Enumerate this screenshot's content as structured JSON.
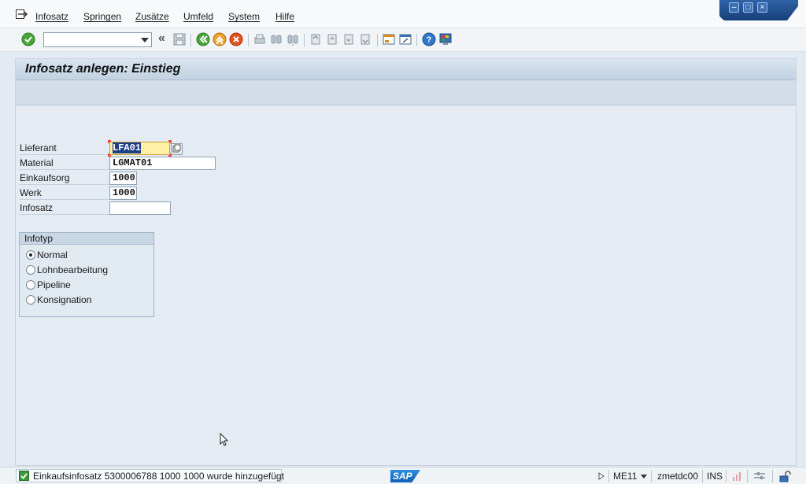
{
  "menubar": {
    "items": [
      "Infosatz",
      "Springen",
      "Zusätze",
      "Umfeld",
      "System",
      "Hilfe"
    ],
    "icon": "menu-icon"
  },
  "window_controls": {
    "minimize": "–",
    "maximize": "□",
    "close": "×"
  },
  "toolbar": {
    "command_field_value": "",
    "back_glyph": "«"
  },
  "screen": {
    "title": "Infosatz anlegen: Einstieg"
  },
  "form": {
    "fields": [
      {
        "label": "Lieferant",
        "value": "LFA01"
      },
      {
        "label": "Material",
        "value": "LGMAT01"
      },
      {
        "label": "Einkaufsorg",
        "value": "1000"
      },
      {
        "label": "Werk",
        "value": "1000"
      },
      {
        "label": "Infosatz",
        "value": ""
      }
    ],
    "infotyp": {
      "title": "Infotyp",
      "options": [
        "Normal",
        "Lohnbearbeitung",
        "Pipeline",
        "Konsignation"
      ],
      "selected": "Normal"
    }
  },
  "statusbar": {
    "message": "Einkaufsinfosatz 5300006788 1000  1000 wurde hinzugefügt",
    "logo": "SAP",
    "transaction": "ME11",
    "server": "zmetdc00",
    "mode": "INS"
  },
  "colors": {
    "title_bg": "#c2d2e2",
    "focus_field": "#fff0a6",
    "selection": "#1c3f86",
    "success": "#3c9a3c",
    "window_bar": "#173f79"
  }
}
